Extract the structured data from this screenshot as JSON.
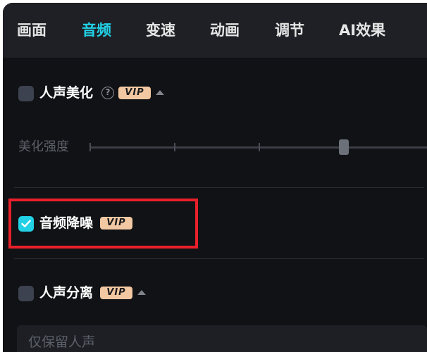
{
  "tabs": [
    {
      "label": "画面",
      "active": false
    },
    {
      "label": "音频",
      "active": true
    },
    {
      "label": "变速",
      "active": false
    },
    {
      "label": "动画",
      "active": false
    },
    {
      "label": "调节",
      "active": false
    },
    {
      "label": "AI效果",
      "active": false
    }
  ],
  "sections": {
    "voice_beautify": {
      "label": "人声美化",
      "checked": false,
      "badge": "VIP",
      "help_icon": "question-circle-icon"
    },
    "beautify_strength": {
      "label": "美化强度",
      "value": 0.6
    },
    "audio_denoise": {
      "label": "音频降噪",
      "checked": true,
      "badge": "VIP"
    },
    "voice_separation": {
      "label": "人声分离",
      "checked": false,
      "badge": "VIP"
    },
    "separation_option": {
      "label": "仅保留人声"
    }
  },
  "colors": {
    "accent": "#22d1e6",
    "vip_badge": "#f2c8a3",
    "highlight": "#e8202a"
  }
}
